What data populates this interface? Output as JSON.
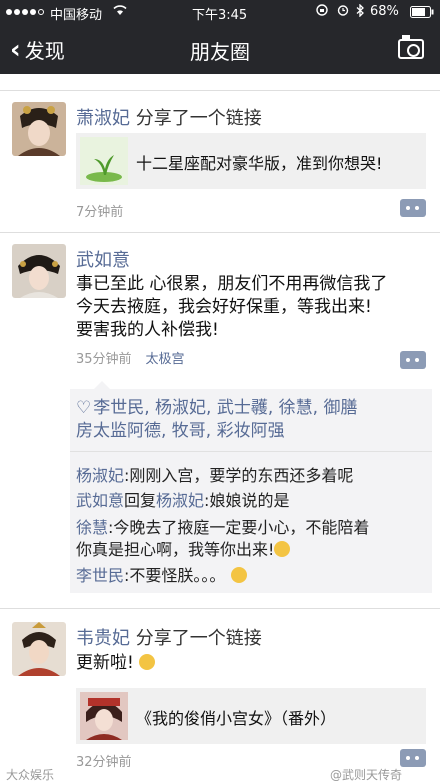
{
  "status_bar": {
    "carrier": "中国移动",
    "time": "下午3:45",
    "battery": "68%",
    "icons": [
      "wifi-icon",
      "rotation-lock-icon",
      "alarm-icon",
      "bluetooth-icon",
      "battery-icon"
    ]
  },
  "nav": {
    "back_label": "发现",
    "title": "朋友圈",
    "camera_icon": "camera-icon"
  },
  "posts": [
    {
      "author": "萧淑妃",
      "action": " 分享了一个链接",
      "link_title": "十二星座配对豪华版，准到你想哭!",
      "time": "7分钟前"
    },
    {
      "author": "武如意",
      "text_lines": [
        "事已至此 心很累，朋友们不用再微信我了",
        "今天去掖庭，我会好好保重，等我出来!",
        "要害我的人补偿我!"
      ],
      "time": "35分钟前",
      "location": "太极宫",
      "likes_line1": "李世民, 杨淑妃, 武士彠, 徐慧, 御膳",
      "likes_line2": "房太监阿德, 牧哥, 彩妆阿强",
      "comments": [
        {
          "name": "杨淑妃",
          "text": ":刚刚入宫，要学的东西还多着呢"
        },
        {
          "name": "武如意",
          "reply": "回复",
          "to": "杨淑妃",
          "text": ":娘娘说的是"
        },
        {
          "name": "徐慧",
          "text": ":今晚去了掖庭一定要小心，不能陪着",
          "text2": "你真是担心啊，我等你出来!"
        },
        {
          "name": "李世民",
          "text": ":不要怪朕。。。"
        }
      ]
    },
    {
      "author": "韦贵妃",
      "action": " 分享了一个链接",
      "text": "更新啦!",
      "link_title": "《我的俊俏小宫女》（番外）",
      "time": "32分钟前"
    }
  ],
  "watermarks": {
    "left": "大众娱乐",
    "right": "@武则天传奇"
  }
}
